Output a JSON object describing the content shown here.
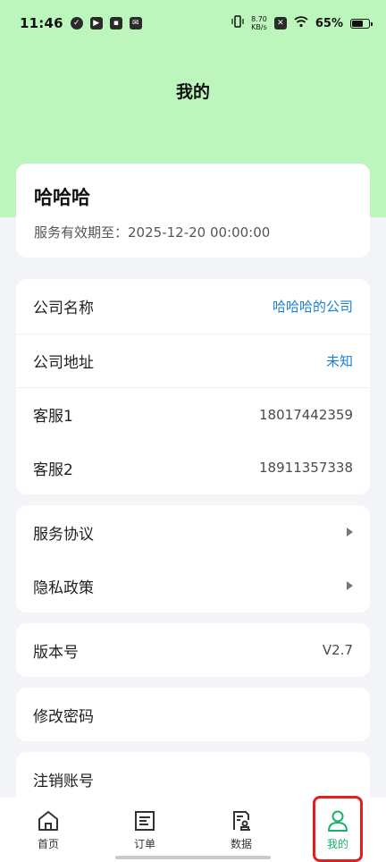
{
  "status_bar": {
    "time": "11:46",
    "speed_value": "8.70",
    "speed_unit": "KB/s",
    "battery": "65%"
  },
  "header": {
    "title": "我的"
  },
  "profile": {
    "name": "哈哈哈",
    "expiry_label": "服务有效期至：",
    "expiry_value": "2025-12-20 00:00:00"
  },
  "info": {
    "company_name_label": "公司名称",
    "company_name_value": "哈哈哈的公司",
    "company_address_label": "公司地址",
    "company_address_value": "未知",
    "service1_label": "客服1",
    "service1_value": "18017442359",
    "service2_label": "客服2",
    "service2_value": "18911357338"
  },
  "policies": {
    "service_agreement": "服务协议",
    "privacy_policy": "隐私政策"
  },
  "version": {
    "label": "版本号",
    "value": "V2.7"
  },
  "change_password": "修改密码",
  "cancel_account": "注销账号",
  "nav": {
    "items": [
      {
        "label": "首页",
        "icon": "home-icon"
      },
      {
        "label": "订单",
        "icon": "order-icon"
      },
      {
        "label": "数据",
        "icon": "data-icon"
      },
      {
        "label": "我的",
        "icon": "user-icon"
      }
    ],
    "active_color": "#18b36a"
  },
  "colors": {
    "header_bg": "#bdf6bd",
    "link": "#1c7fcf",
    "page_bg": "#f3f4f7"
  }
}
